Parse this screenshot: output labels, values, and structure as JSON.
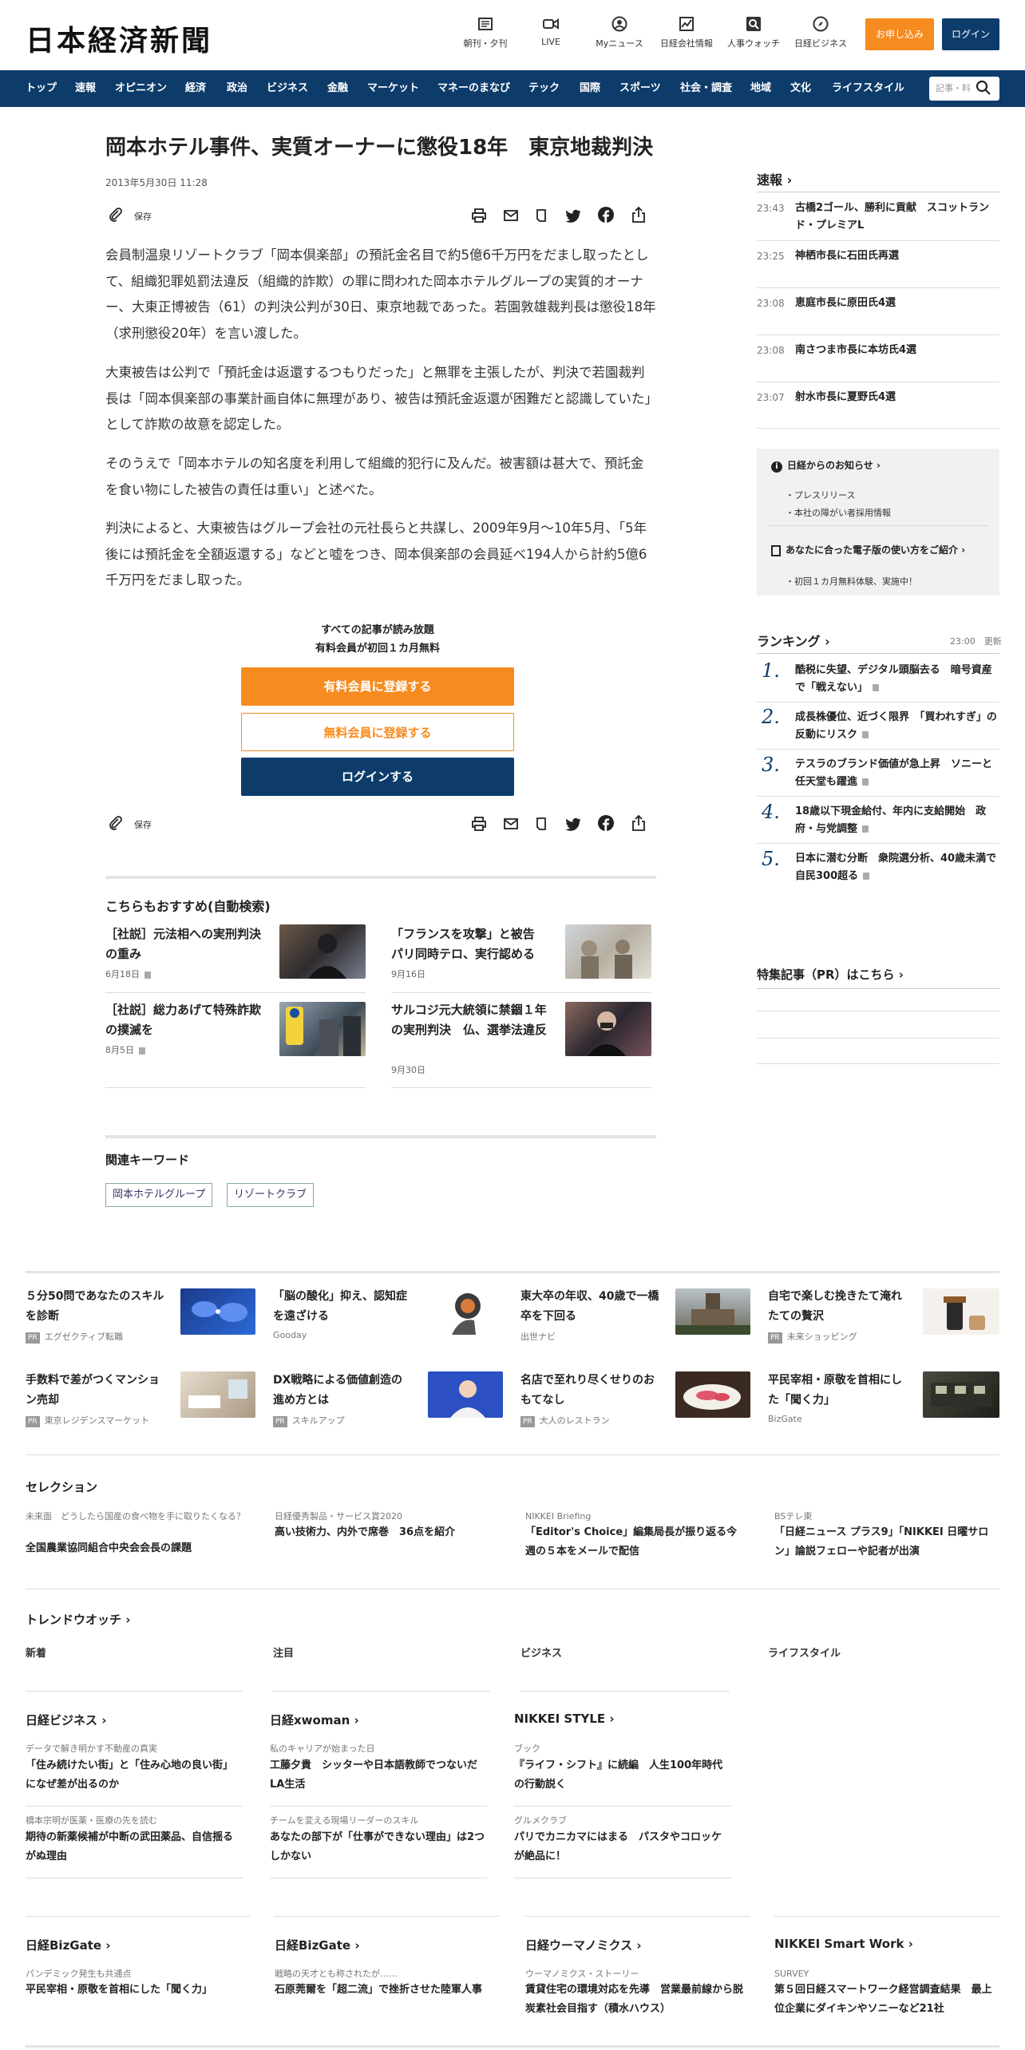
{
  "header": {
    "logo": "日本経済新聞",
    "icons": [
      {
        "label": "朝刊・夕刊",
        "icon": "newspaper-icon"
      },
      {
        "label": "LIVE",
        "icon": "video-icon"
      },
      {
        "label": "Myニュース",
        "icon": "user-icon"
      },
      {
        "label": "日経会社情報",
        "icon": "chart-icon"
      },
      {
        "label": "人事ウォッチ",
        "icon": "search-icon"
      },
      {
        "label": "日経ビジネス",
        "icon": "compass-icon"
      }
    ],
    "subscribe": "お申し込み",
    "login": "ログイン"
  },
  "nav": {
    "items": [
      "トップ",
      "速報",
      "オピニオン",
      "経済",
      "政治",
      "ビジネス",
      "金融",
      "マーケット",
      "マネーのまなび",
      "テック",
      "国際",
      "スポーツ",
      "社会・調査",
      "地域",
      "文化",
      "ライフスタイル"
    ],
    "search_placeholder": "記事・料"
  },
  "article": {
    "title": "岡本ホテル事件、実質オーナーに懲役18年　東京地裁判決",
    "date": "2013年5月30日 11:28",
    "save": "保存",
    "paragraphs": [
      "会員制温泉リゾートクラブ「岡本倶楽部」の預託金名目で約5億6千万円をだまし取ったとして、組織犯罪処罰法違反（組織的詐欺）の罪に問われた岡本ホテルグループの実質的オーナー、大東正博被告（61）の判決公判が30日、東京地裁であった。若園敦雄裁判長は懲役18年（求刑懲役20年）を言い渡した。",
      "大東被告は公判で「預託金は返還するつもりだった」と無罪を主張したが、判決で若園裁判長は「岡本倶楽部の事業計画自体に無理があり、被告は預託金返還が困難だと認識していた」として詐欺の故意を認定した。",
      "そのうえで「岡本ホテルの知名度を利用して組織的犯行に及んだ。被害額は甚大で、預託金を食い物にした被告の責任は重い」と述べた。",
      "判決によると、大東被告はグループ会社の元社長らと共謀し、2009年9月～10年5月、「5年後には預託金を全額返還する」などと嘘をつき、岡本倶楽部の会員延べ194人から計約5億6千万円をだまし取った。"
    ],
    "cta_line1": "すべての記事が読み放題",
    "cta_line2": "有料会員が初回１カ月無料",
    "cta_paid": "有料会員に登録する",
    "cta_free": "無料会員に登録する",
    "cta_login": "ログインする"
  },
  "recommend": {
    "heading": "こちらもおすすめ(自動検索)",
    "items": [
      {
        "title": "［社説］元法相への実刑判決の重み",
        "date": "6月18日",
        "locked": true
      },
      {
        "title": "「フランスを攻撃」と被告　パリ同時テロ、実行認める",
        "date": "9月16日",
        "locked": false
      },
      {
        "title": "［社説］総力あげて特殊詐欺の撲滅を",
        "date": "8月5日",
        "locked": true
      },
      {
        "title": "サルコジ元大統領に禁錮１年の実刑判決　仏、選挙法違反",
        "date": "9月30日",
        "locked": false
      }
    ]
  },
  "keywords": {
    "heading": "関連キーワード",
    "items": [
      "岡本ホテルグループ",
      "リゾートクラブ"
    ]
  },
  "sidebar": {
    "sokuho": "速報",
    "news": [
      {
        "time": "23:43",
        "text": "古橋2ゴール、勝利に貢献　スコットランド・プレミアL"
      },
      {
        "time": "23:25",
        "text": "神栖市長に石田氏再選"
      },
      {
        "time": "23:08",
        "text": "恵庭市長に原田氏4選"
      },
      {
        "time": "23:08",
        "text": "南さつま市長に本坊氏4選"
      },
      {
        "time": "23:07",
        "text": "射水市長に夏野氏4選"
      }
    ],
    "notice_head": "日経からのお知らせ",
    "notice_items": [
      "プレスリリース",
      "本社の障がい者採用情報"
    ],
    "epaper_head": "あなたに合った電子版の使い方をご紹介",
    "epaper_items": [
      "初回１カ月無料体験、実施中！"
    ],
    "ranking_head": "ランキング",
    "ranking_time": "23:00",
    "ranking_update": "更新",
    "ranking": [
      {
        "n": "1.",
        "text": "酷税に失望、デジタル頭脳去る　暗号資産で「戦えない」"
      },
      {
        "n": "2.",
        "text": "成長株優位、近づく限界　「買われすぎ」の反動にリスク"
      },
      {
        "n": "3.",
        "text": "テスラのブランド価値が急上昇　ソニーと任天堂も躍進"
      },
      {
        "n": "4.",
        "text": "18歳以下現金給付、年内に支給開始　政府・与党調整"
      },
      {
        "n": "5.",
        "text": "日本に潜む分断　衆院選分析、40歳未満で自民300超る"
      }
    ],
    "pr_head": "特集記事（PR）はこちら"
  },
  "ads": [
    {
      "title": "５分50問であなたのスキルを診断",
      "src": "エグゼクティブ転職",
      "pr": true
    },
    {
      "title": "「脳の酸化」抑え、認知症を遠ざける",
      "src": "Gooday",
      "pr": false
    },
    {
      "title": "東大卒の年収、40歳で一橋卒を下回る",
      "src": "出世ナビ",
      "pr": false
    },
    {
      "title": "自宅で楽しむ挽きたて淹れたての贅沢",
      "src": "未来ショッピング",
      "pr": true
    },
    {
      "title": "手数料で差がつくマンション売却",
      "src": "東京レジデンスマーケット",
      "pr": true
    },
    {
      "title": "DX戦略による価値創造の進め方とは",
      "src": "スキルアップ",
      "pr": true
    },
    {
      "title": "名店で至れり尽くせりのおもてなし",
      "src": "大人のレストラン",
      "pr": true
    },
    {
      "title": "平民宰相・原敬を首相にした「聞く力」",
      "src": "BizGate",
      "pr": false
    }
  ],
  "selection": {
    "heading": "セレクション",
    "items": [
      {
        "sub": "未来面　どうしたら国産の食べ物を手に取りたくなる？",
        "title": "全国農業協同組合中央会会長の課題"
      },
      {
        "sub": "日経優秀製品・サービス賞2020",
        "title": "高い技術力、内外で席巻　36点を紹介"
      },
      {
        "sub": "NIKKEI Briefing",
        "title": "「Editor's Choice」編集局長が振り返る今週の５本をメールで配信"
      },
      {
        "sub": "BSテレ東",
        "title": "「日経ニュース プラス9」「NIKKEI 日曜サロン」論説フェローや記者が出演"
      }
    ]
  },
  "trend": {
    "heading": "トレンドウオッチ",
    "tabs": [
      "新着",
      "注目",
      "ビジネス",
      "ライフスタイル"
    ]
  },
  "media": [
    {
      "head": "日経ビジネス",
      "items": [
        {
          "sub": "データで解き明かす不動産の真実",
          "title": "「住み続けたい街」と「住み心地の良い街」になぜ差が出るのか"
        },
        {
          "sub": "橋本宗明が医薬・医療の先を読む",
          "title": "期待の新薬候補が中断の武田薬品、自信揺るがぬ理由"
        }
      ]
    },
    {
      "head": "日経xwoman",
      "items": [
        {
          "sub": "私のキャリアが始まった日",
          "title": "工藤夕貴　シッターや日本語教師でつないだLA生活"
        },
        {
          "sub": "チームを変える現場リーダーのスキル",
          "title": "あなたの部下が「仕事ができない理由」は2つしかない"
        }
      ]
    },
    {
      "head": "NIKKEI STYLE",
      "items": [
        {
          "sub": "ブック",
          "title": "『ライフ・シフト』に続編　人生100年時代の行動説く"
        },
        {
          "sub": "グルメクラブ",
          "title": "パリでカニカマにはまる　パスタやコロッケが絶品に！"
        }
      ]
    }
  ],
  "bottom": [
    {
      "head": "日経BizGate",
      "sub": "パンデミック発生も共通点",
      "title": "平民宰相・原敬を首相にした「聞く力」"
    },
    {
      "head": "日経BizGate",
      "sub": "戦略の天才とも称されたが……",
      "title": "石原莞爾を「超二流」で挫折させた陸軍人事"
    },
    {
      "head": "日経ウーマノミクス",
      "sub": "ウーマノミクス・ストーリー",
      "title": "賃貸住宅の環境対応を先導　営業最前線から脱炭素社会目指す（積水ハウス）"
    },
    {
      "head": "NIKKEI Smart Work",
      "sub": "SURVEY",
      "title": "第５回日経スマートワーク経営調査結果　最上位企業にダイキンやソニーなど21社"
    }
  ],
  "colors": {
    "navy": "#0d3c6b",
    "orange": "#f68b1f"
  }
}
